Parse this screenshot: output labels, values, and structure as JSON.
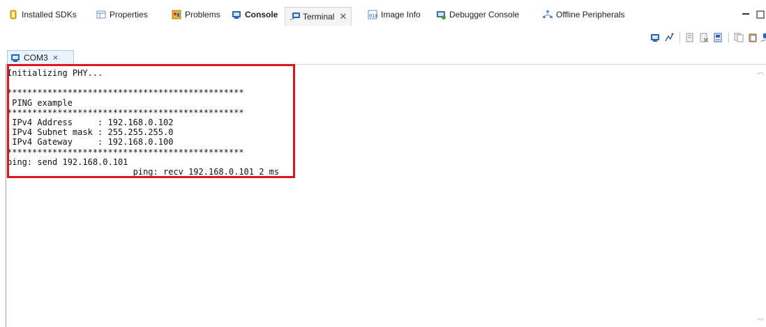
{
  "tabs": [
    {
      "label": "Installed SDKs",
      "icon": "sdk-icon"
    },
    {
      "label": "Properties",
      "icon": "properties-icon"
    },
    {
      "label": "Problems",
      "icon": "problems-icon"
    },
    {
      "label": "Console",
      "icon": "console-icon",
      "bold": true
    },
    {
      "label": "Terminal",
      "icon": "terminal-icon",
      "active": true,
      "closable": true
    },
    {
      "label": "Image Info",
      "icon": "image-info-icon"
    },
    {
      "label": "Debugger Console",
      "icon": "debugger-console-icon"
    },
    {
      "label": "Offline Peripherals",
      "icon": "offline-peripherals-icon"
    }
  ],
  "console_tab": {
    "label": "COM3",
    "close": "×"
  },
  "console": {
    "lines": [
      "Initializing PHY...",
      "",
      "***********************************************",
      " PING example",
      "***********************************************",
      " IPv4 Address     : 192.168.0.102",
      " IPv4 Subnet mask : 255.255.255.0",
      " IPv4 Gateway     : 192.168.0.100",
      "***********************************************",
      "ping: send 192.168.0.101",
      "                         ping: recv 192.168.0.101 2 ms"
    ]
  },
  "colors": {
    "highlight": "#e0141e",
    "tab_active_bg": "#f4f4f4",
    "console_tab_bg": "#eaf2fb"
  },
  "window_controls": {
    "minimize": "▭",
    "maximize": "☐"
  }
}
